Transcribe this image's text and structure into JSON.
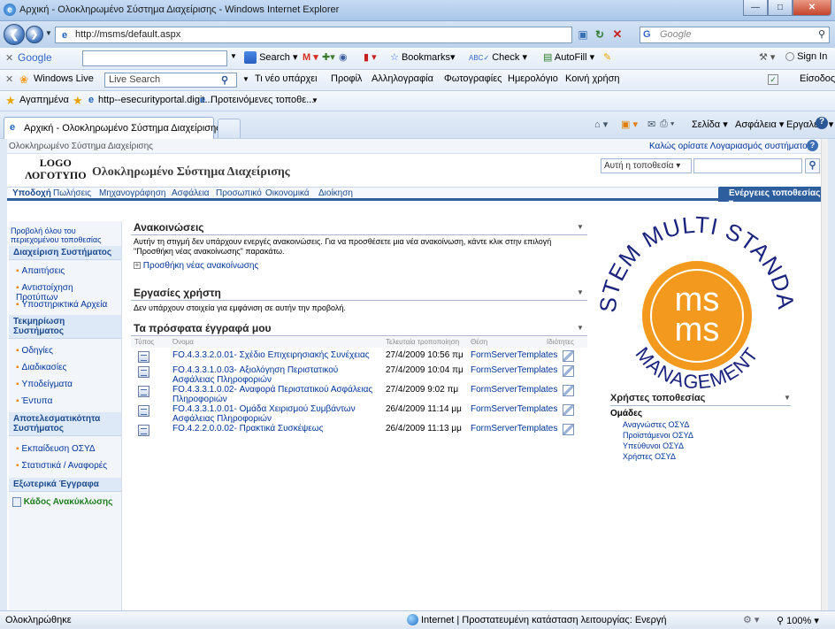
{
  "window": {
    "title": "Αρχική - Ολοκληρωμένο Σύστημα Διαχείρισης - Windows Internet Explorer"
  },
  "address_bar": {
    "url": "http://msms/default.aspx",
    "search_placeholder": "Google"
  },
  "google_toolbar": {
    "brand": "Google",
    "search_label": "Search",
    "bookmarks_label": "Bookmarks",
    "check_label": "Check",
    "autofill_label": "AutoFill",
    "signin_label": "Sign In"
  },
  "windows_live_toolbar": {
    "brand": "Windows Live",
    "search_placeholder": "Live Search",
    "links": [
      "Τι νέο υπάρχει",
      "Προφίλ",
      "Αλληλογραφία",
      "Φωτογραφίες",
      "Ημερολόγιο",
      "Κοινή χρήση"
    ],
    "signin": "Είσοδος"
  },
  "favorites_bar": {
    "favorites": "Αγαπημένα",
    "items": [
      "http--esecurityportal.digit...",
      "Προτεινόμενες τοποθε..."
    ]
  },
  "tab": {
    "label": "Αρχική - Ολοκληρωμένο Σύστημα Διαχείρισης",
    "commands": [
      "Σελίδα",
      "Ασφάλεια",
      "Εργαλεία"
    ]
  },
  "sharepoint": {
    "breadcrumb": "Ολοκληρωμένο Σύστημα Διαχείρισης",
    "welcome": "Καλώς ορίσατε Λογαριασμός συστήματος",
    "logo_line1": "LOGO",
    "logo_line2": "ΛΟΓΟΤΥΠΟ",
    "site_title": "Ολοκληρωμένο Σύστημα Διαχείρισης",
    "search_scope": "Αυτή η τοποθεσία",
    "tabs": [
      "Υποδοχή",
      "Πωλήσεις",
      "Μηχανογράφηση",
      "Ασφάλεια",
      "Προσωπικό",
      "Οικονομικά",
      "Διοίκηση"
    ],
    "site_actions": "Ενέργειες τοποθεσίας"
  },
  "quicklaunch": {
    "view_all": "Προβολή όλου του περιεχομένου τοποθεσίας",
    "groups": [
      {
        "title": "Διαχείριση Συστήματος",
        "items": [
          "Απαιτήσεις",
          "Αντιστοίχηση Προτύπων",
          "Υποστηρικτικά Αρχεία"
        ]
      },
      {
        "title": "Τεκμηρίωση Συστήματος",
        "items": [
          "Οδηγίες",
          "Διαδικασίες",
          "Υποδείγματα",
          "Έντυπα"
        ]
      },
      {
        "title": "Αποτελεσματικότητα Συστήματος",
        "items": [
          "Εκπαίδευση ΟΣΥΔ",
          "Στατιστικά / Αναφορές"
        ]
      },
      {
        "title": "Εξωτερικά Έγγραφα",
        "items": []
      }
    ],
    "recycle": "Κάδος Ανακύκλωσης"
  },
  "announcements": {
    "title": "Ανακοινώσεις",
    "empty": "Αυτήν τη στιγμή δεν υπάρχουν ενεργές ανακοινώσεις. Για να προσθέσετε μια νέα ανακοίνωση, κάντε κλικ στην επιλογή \"Προσθήκη νέας ανακοίνωσης\" παρακάτω.",
    "add": "Προσθήκη νέας ανακοίνωσης"
  },
  "tasks": {
    "title": "Εργασίες χρήστη",
    "empty": "Δεν υπάρχουν στοιχεία για εμφάνιση σε αυτήν την προβολή."
  },
  "recent_docs": {
    "title": "Τα πρόσφατα έγγραφά μου",
    "columns": [
      "Τύπος",
      "Όνομα",
      "Τελευταία τροποποίηση",
      "Θέση",
      "Ιδιότητες"
    ],
    "rows": [
      {
        "name": "FO.4.3.3.2.0.01- Σχέδιο Επιχειρησιακής Συνέχειας",
        "modified": "27/4/2009 10:56 πμ",
        "location": "FormServerTemplates"
      },
      {
        "name": "FO.4.3.3.1.0.03- Αξιολόγηση Περιστατικού Ασφάλειας Πληροφοριών",
        "modified": "27/4/2009 10:04 πμ",
        "location": "FormServerTemplates"
      },
      {
        "name": "FO.4.3.3.1.0.02- Αναφορά Περιστατικού Ασφάλειας Πληροφοριών",
        "modified": "27/4/2009 9:02 πμ",
        "location": "FormServerTemplates"
      },
      {
        "name": "FO.4.3.3.1.0.01- Ομάδα Χειρισμού Συμβάντων Ασφάλειας Πληροφοριών",
        "modified": "26/4/2009 11:14 μμ",
        "location": "FormServerTemplates"
      },
      {
        "name": "FO.4.2.2.0.0.02- Πρακτικά Συσκέψεως",
        "modified": "26/4/2009 11:13 μμ",
        "location": "FormServerTemplates"
      }
    ]
  },
  "logo_badge": {
    "text_top": "SYSTEM MULTI STANDARD",
    "text_bottom": "MANAGEMENT",
    "center": "ms"
  },
  "site_users": {
    "title": "Χρήστες τοποθεσίας",
    "groups_label": "Ομάδες",
    "groups": [
      "Αναγνώστες ΟΣΥΔ",
      "Προϊστάμενοι ΟΣΥΔ",
      "Υπεύθυνοι ΟΣΥΔ",
      "Χρήστες ΟΣΥΔ"
    ]
  },
  "status": {
    "left": "Ολοκληρώθηκε",
    "zone": "Internet | Προστατευμένη κατάσταση λειτουργίας: Ενεργή",
    "zoom": "100%"
  },
  "colors": {
    "accent": "#1d4b8d",
    "orange": "#f39a1e",
    "site_actions_bg": "#2f5e9e"
  }
}
